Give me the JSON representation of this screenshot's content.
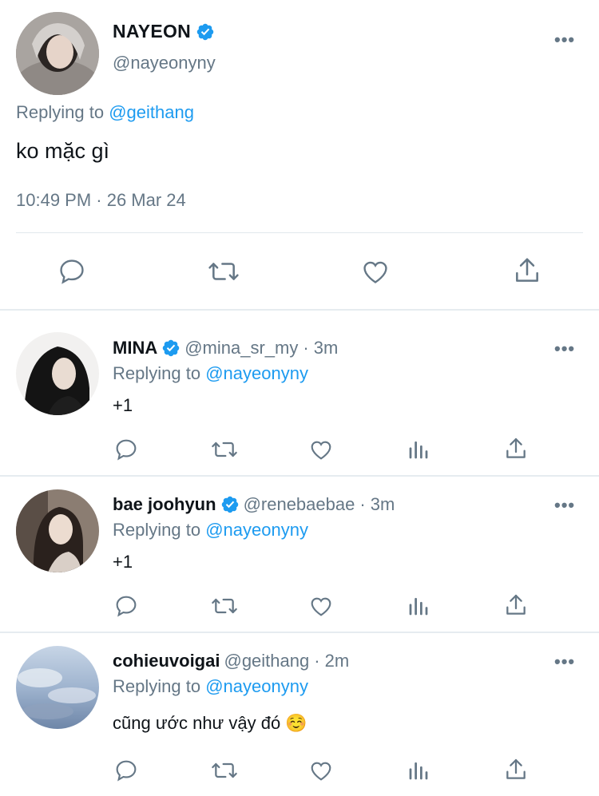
{
  "main_tweet": {
    "author_name": "NAYEON",
    "verified": true,
    "handle": "@nayeonyny",
    "more_label": "•••",
    "replying_label": "Replying to",
    "replying_to": "@geithang",
    "text": "ko mặc gì",
    "timestamp": "10:49 PM · 26 Mar 24",
    "actions": [
      "reply-icon",
      "retweet-icon",
      "like-icon",
      "share-icon"
    ]
  },
  "replies": [
    {
      "author_name": "MINA",
      "verified": true,
      "handle": "@mina_sr_my",
      "time": "· 3m",
      "replying_label": "Replying to",
      "replying_to": "@nayeonyny",
      "text": "+1",
      "more_label": "•••"
    },
    {
      "author_name": "bae joohyun",
      "verified": true,
      "handle": "@renebaebae",
      "time": "· 3m",
      "replying_label": "Replying to",
      "replying_to": "@nayeonyny",
      "text": "+1",
      "more_label": "•••"
    },
    {
      "author_name": "cohieuvoigai",
      "verified": false,
      "handle": "@geithang",
      "time": "· 2m",
      "replying_label": "Replying to",
      "replying_to": "@nayeonyny",
      "text": "cũng ước như vậy đó ☺️",
      "more_label": "•••"
    }
  ],
  "colors": {
    "link": "#1d9bf0",
    "secondary_text": "#657786",
    "primary_text": "#0f1419",
    "divider": "#e1e8ed",
    "verified_badge": "#1d9bf0"
  }
}
